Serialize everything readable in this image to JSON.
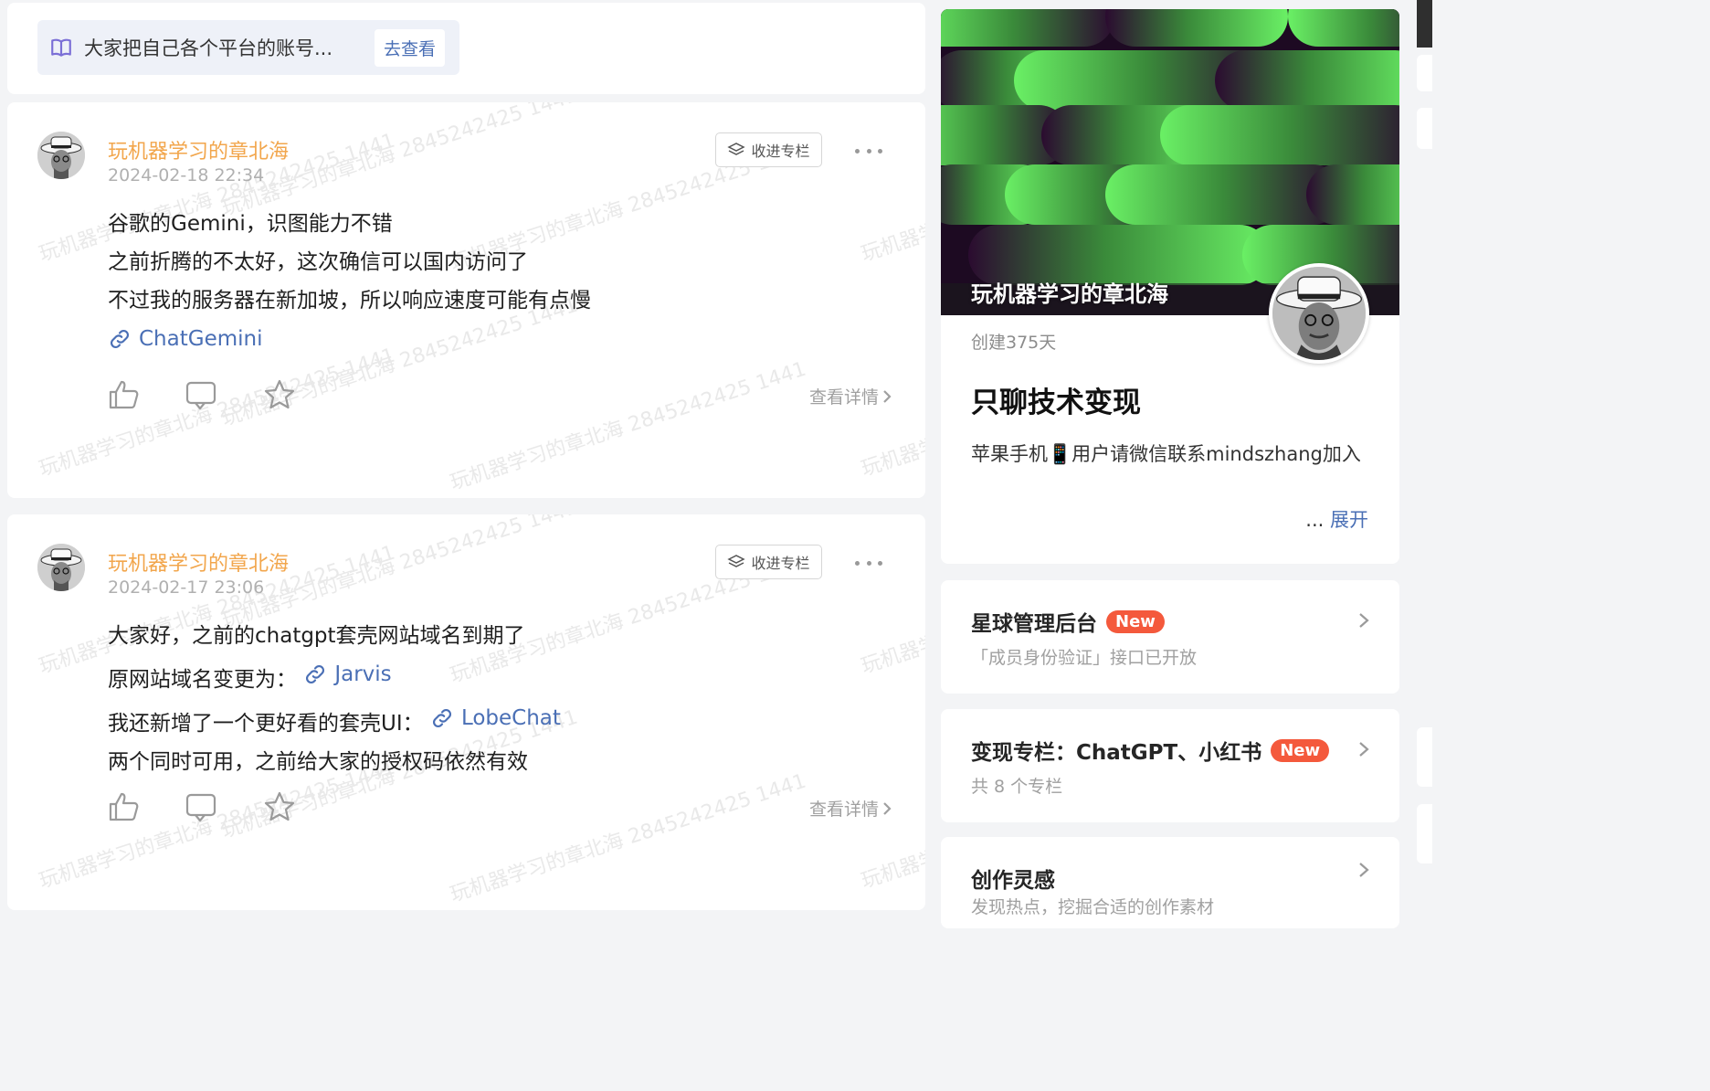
{
  "notice": {
    "text": "大家把自己各个平台的账号...",
    "button": "去查看"
  },
  "watermark": "玩机器学习的章北海 2845242425 1441",
  "posts": [
    {
      "author": "玩机器学习的章北海",
      "time": "2024-02-18 22:34",
      "collect": "收进专栏",
      "lines": [
        "谷歌的Gemini，识图能力不错",
        "之前折腾的不太好，这次确信可以国内访问了",
        "不过我的服务器在新加坡，所以响应速度可能有点慢"
      ],
      "link": "ChatGemini",
      "detail": "查看详情"
    },
    {
      "author": "玩机器学习的章北海",
      "time": "2024-02-17 23:06",
      "collect": "收进专栏",
      "line1": "大家好，之前的chatgpt套壳网站域名到期了",
      "line2_prefix": "原网站域名变更为：",
      "link2": "Jarvis",
      "line3_prefix": "我还新增了一个更好看的套壳UI：",
      "link3": "LobeChat",
      "line4": "两个同时可用，之前给大家的授权码依然有效",
      "detail": "查看详情"
    }
  ],
  "profile": {
    "cover_name": "玩机器学习的章北海",
    "created": "创建375天",
    "title": "只聊技术变现",
    "desc": "苹果手机📱用户请微信联系mindszhang加入",
    "expand_prefix": "...",
    "expand": "展开"
  },
  "menus": [
    {
      "title": "星球管理后台",
      "badge": "New",
      "sub": "「成员身份验证」接口已开放"
    },
    {
      "title": "变现专栏：ChatGPT、小红书",
      "badge": "New",
      "sub": "共 8 个专栏"
    },
    {
      "title": "创作灵感",
      "sub": "发现热点，挖掘合适的创作素材"
    }
  ],
  "colors": {
    "accent_link": "#4a6fb5",
    "author": "#f2a64c",
    "badge": "#f4593c"
  }
}
